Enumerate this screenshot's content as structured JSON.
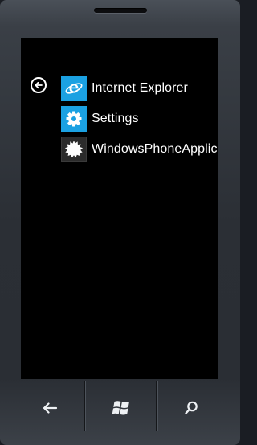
{
  "apps": [
    {
      "label": "Internet Explorer",
      "icon": "internet-explorer-icon",
      "tile_color": "#1ba1e2"
    },
    {
      "label": "Settings",
      "icon": "gear-icon",
      "tile_color": "#1ba1e2"
    },
    {
      "label": "WindowsPhoneApplic",
      "icon": "starburst-icon",
      "tile_color": "#2b2b2b"
    }
  ],
  "navigation": {
    "back_icon": "back-arrow-icon",
    "start_icon": "windows-logo-icon",
    "search_icon": "search-icon"
  },
  "colors": {
    "accent": "#1ba1e2",
    "screen_background": "#000000",
    "text": "#ffffff"
  }
}
